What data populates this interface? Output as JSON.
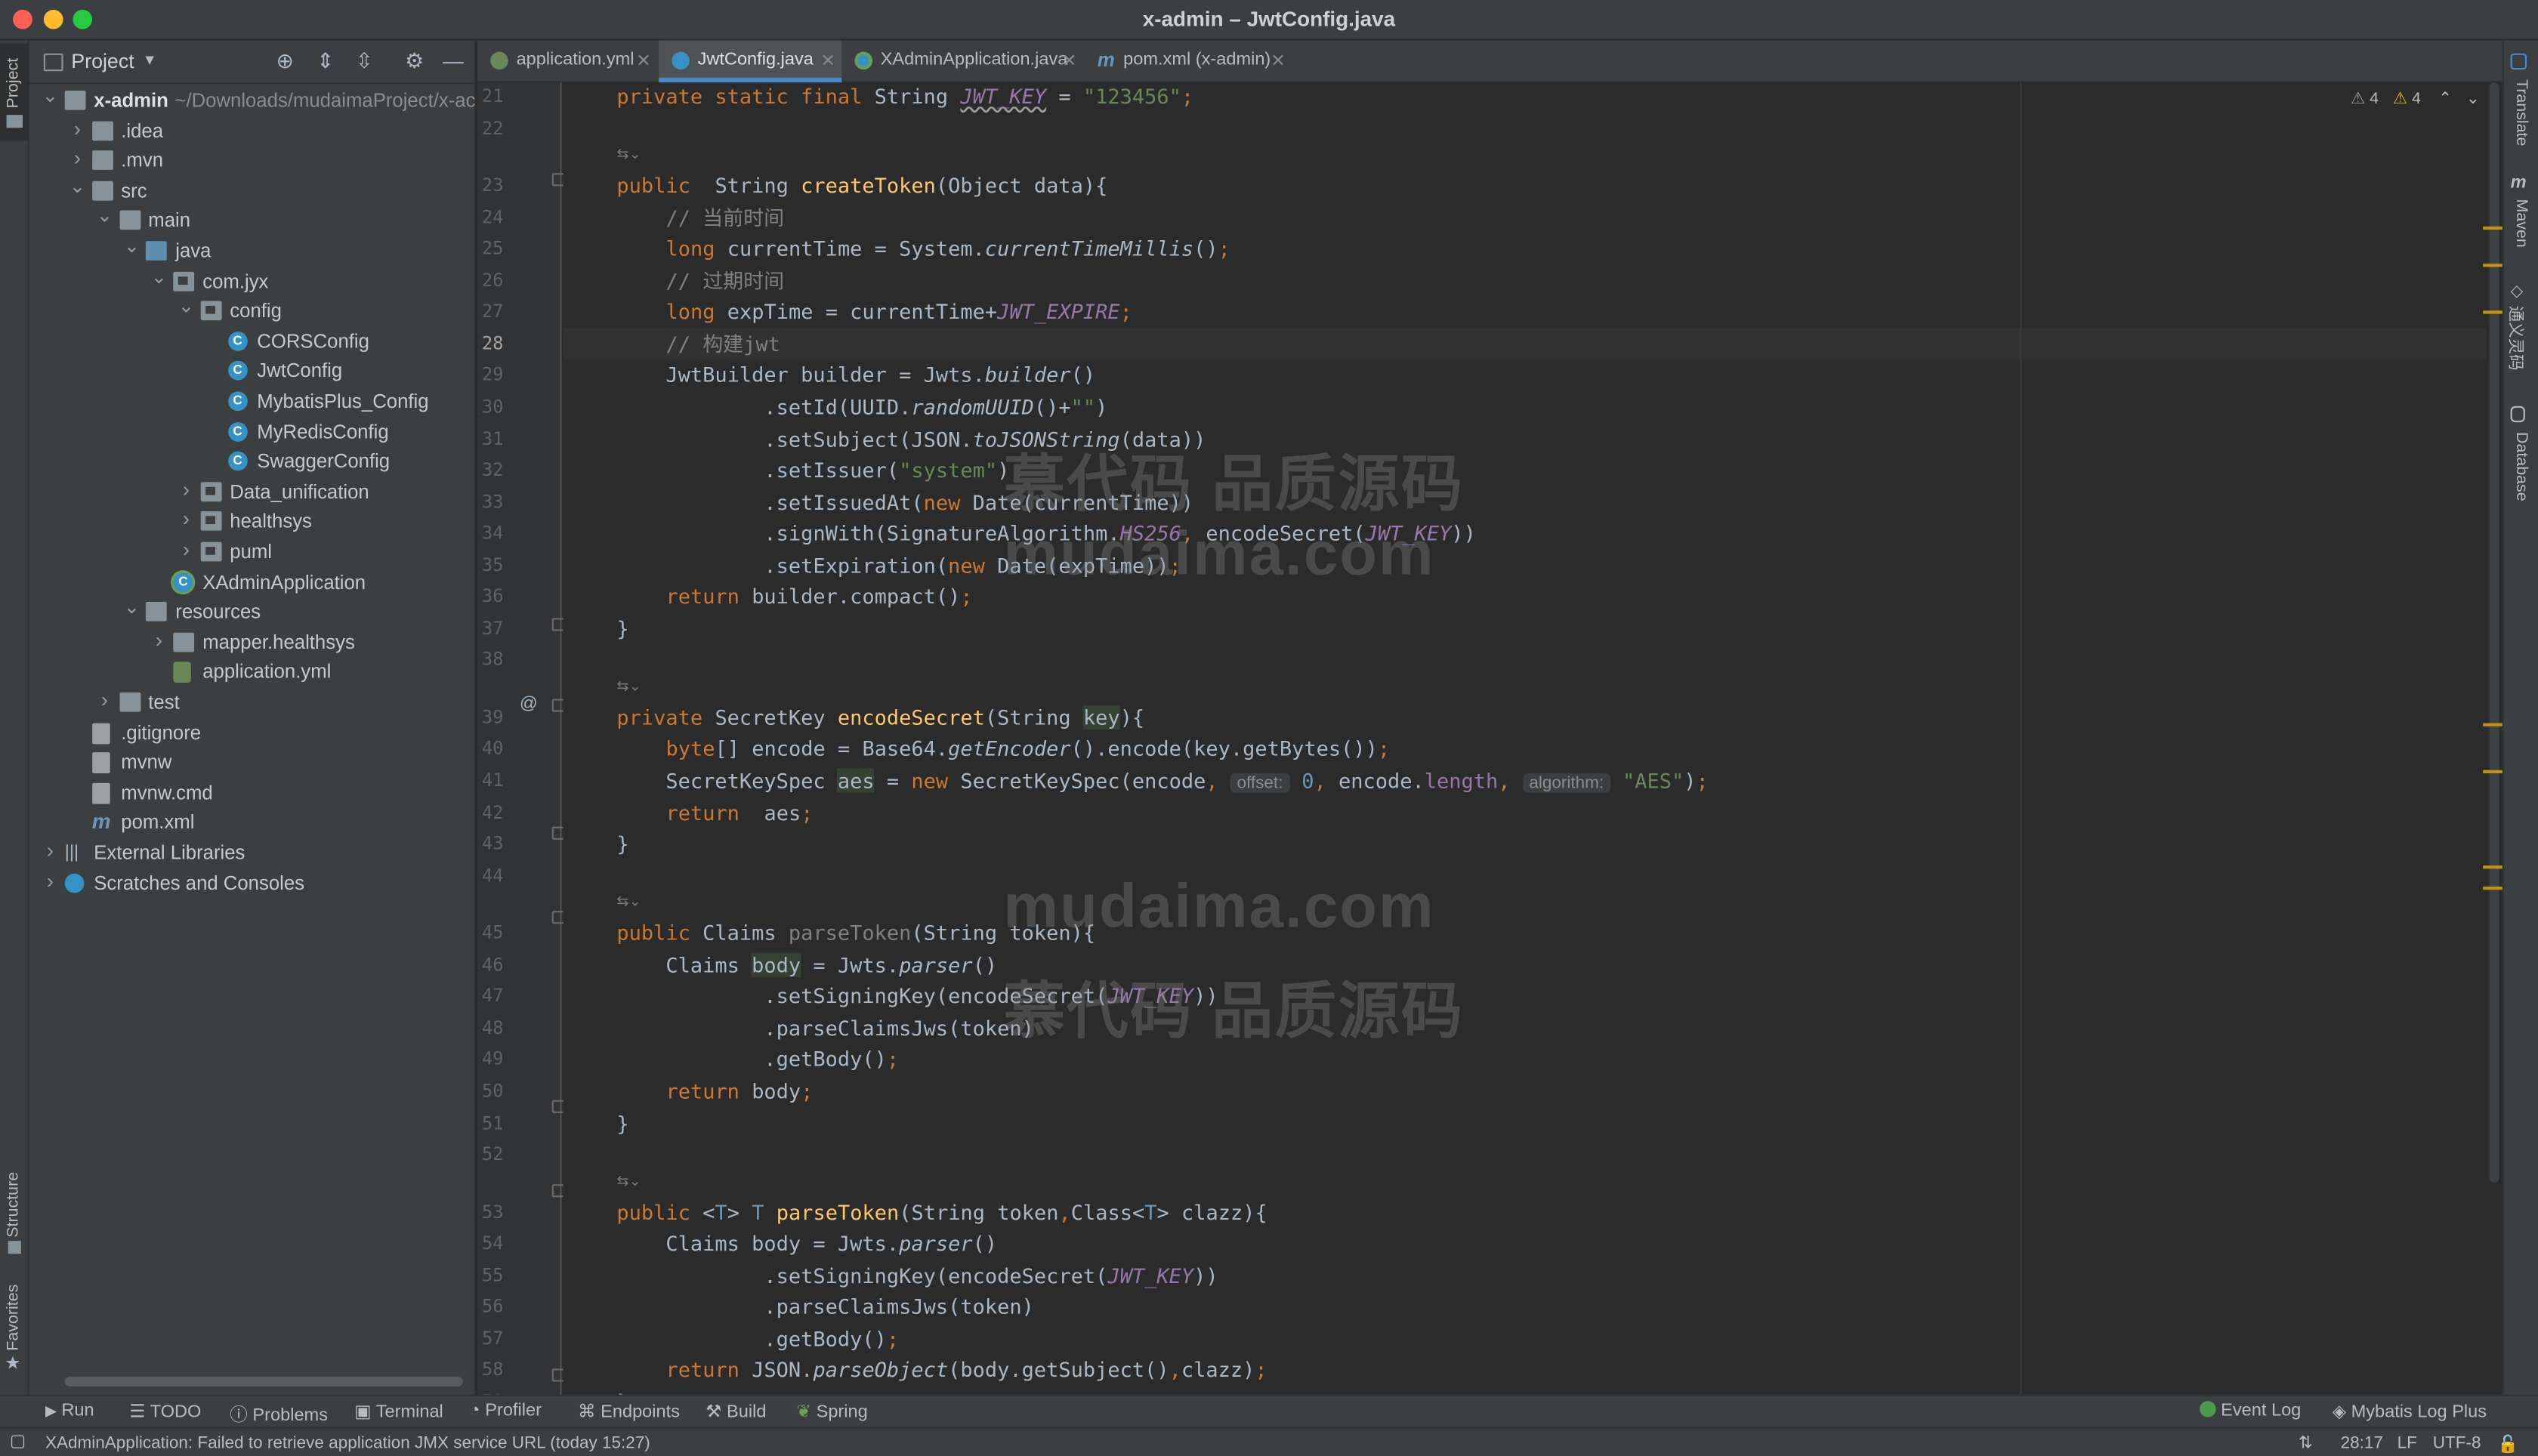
{
  "window": {
    "title": "x-admin – JwtConfig.java"
  },
  "left_stripe": {
    "project_label": "Project",
    "structure_label": "Structure",
    "favorites_label": "Favorites"
  },
  "project_panel": {
    "title": "Project",
    "tree": [
      {
        "label": "x-admin",
        "extra": " ~/Downloads/mudaimaProject/x-ac",
        "icon": "module-folder-icon",
        "expanded": true,
        "bold": true
      },
      {
        "label": ".idea",
        "icon": "folder-icon",
        "expanded": false
      },
      {
        "label": ".mvn",
        "icon": "folder-icon",
        "expanded": false
      },
      {
        "label": "src",
        "icon": "folder-icon",
        "expanded": true
      },
      {
        "label": "main",
        "icon": "folder-icon",
        "expanded": true
      },
      {
        "label": "java",
        "icon": "source-folder-icon",
        "expanded": true
      },
      {
        "label": "com.jyx",
        "icon": "package-icon",
        "expanded": true
      },
      {
        "label": "config",
        "icon": "package-icon",
        "expanded": true
      },
      {
        "label": "CORSConfig",
        "icon": "class-icon"
      },
      {
        "label": "JwtConfig",
        "icon": "class-icon"
      },
      {
        "label": "MybatisPlus_Config",
        "icon": "class-icon"
      },
      {
        "label": "MyRedisConfig",
        "icon": "class-icon"
      },
      {
        "label": "SwaggerConfig",
        "icon": "class-icon"
      },
      {
        "label": "Data_unification",
        "icon": "package-icon",
        "expanded": false
      },
      {
        "label": "healthsys",
        "icon": "package-icon",
        "expanded": false
      },
      {
        "label": "puml",
        "icon": "package-icon",
        "expanded": false
      },
      {
        "label": "XAdminApplication",
        "icon": "spring-class-icon"
      },
      {
        "label": "resources",
        "icon": "resources-folder-icon",
        "expanded": true
      },
      {
        "label": "mapper.healthsys",
        "icon": "folder-icon",
        "expanded": false
      },
      {
        "label": "application.yml",
        "icon": "yml-file-icon"
      },
      {
        "label": "test",
        "icon": "folder-icon",
        "expanded": false
      },
      {
        "label": ".gitignore",
        "icon": "gitignore-file-icon"
      },
      {
        "label": "mvnw",
        "icon": "script-file-icon"
      },
      {
        "label": "mvnw.cmd",
        "icon": "script-file-icon"
      },
      {
        "label": "pom.xml",
        "icon": "maven-file-icon"
      },
      {
        "label": "External Libraries",
        "icon": "library-icon",
        "expanded": false
      },
      {
        "label": "Scratches and Consoles",
        "icon": "scratches-icon",
        "expanded": false
      }
    ]
  },
  "tabs": [
    {
      "label": "application.yml",
      "icon": "yml-file-icon",
      "color": "#6a8759"
    },
    {
      "label": "JwtConfig.java",
      "icon": "class-icon",
      "color": "#3592c4"
    },
    {
      "label": "XAdminApplication.java",
      "icon": "spring-class-icon",
      "color": "#3592c4"
    },
    {
      "label": "pom.xml (x-admin)",
      "icon": "maven-file-icon",
      "color": "#6897bb"
    }
  ],
  "inspections": {
    "weak_warnings": "4",
    "warnings": "4"
  },
  "right_stripe": {
    "translate_label": "Translate",
    "maven_label": "Maven",
    "translation_label": "通义灵码",
    "database_label": "Database"
  },
  "editor": {
    "current_line": "28",
    "lines": [
      {
        "n": "21",
        "t": [
          [
            "kw",
            "private static final "
          ],
          [
            "",
            "String "
          ],
          [
            "st sq",
            "JWT_KEY"
          ],
          [
            "",
            " = "
          ],
          [
            "str",
            "\"123456\""
          ],
          [
            "kw",
            ";"
          ]
        ]
      },
      {
        "n": "22",
        "t": []
      },
      {
        "n": "",
        "t": [
          [
            "gr",
            "    "
          ]
        ]
      },
      {
        "n": "23",
        "t": [
          [
            "kw",
            "public  "
          ],
          [
            "",
            "String "
          ],
          [
            "fn",
            "createToken"
          ],
          [
            "",
            "(Object data){"
          ]
        ]
      },
      {
        "n": "24",
        "t": [
          [
            "",
            "    "
          ],
          [
            "cm",
            "// 当前时间"
          ]
        ]
      },
      {
        "n": "25",
        "t": [
          [
            "",
            "    "
          ],
          [
            "kw",
            "long "
          ],
          [
            "",
            "currentTime = System."
          ],
          [
            "it",
            "currentTimeMillis"
          ],
          [
            "",
            "()"
          ],
          [
            "kw",
            ";"
          ]
        ]
      },
      {
        "n": "26",
        "t": [
          [
            "",
            "    "
          ],
          [
            "cm",
            "// 过期时间"
          ]
        ]
      },
      {
        "n": "27",
        "t": [
          [
            "",
            "    "
          ],
          [
            "kw",
            "long "
          ],
          [
            "",
            "expTime = currentTime+"
          ],
          [
            "st",
            "JWT_EXPIRE"
          ],
          [
            "kw",
            ";"
          ]
        ]
      },
      {
        "n": "28",
        "t": [
          [
            "",
            "    "
          ],
          [
            "cm",
            "// 构建jwt"
          ]
        ]
      },
      {
        "n": "29",
        "t": [
          [
            "",
            "    JwtBuilder builder = Jwts."
          ],
          [
            "it",
            "builder"
          ],
          [
            "",
            "()"
          ]
        ]
      },
      {
        "n": "30",
        "t": [
          [
            "",
            "            .setId(UUID."
          ],
          [
            "it",
            "randomUUID"
          ],
          [
            "",
            "()+"
          ],
          [
            "str",
            "\"\""
          ],
          [
            "",
            ")"
          ]
        ]
      },
      {
        "n": "31",
        "t": [
          [
            "",
            "            .setSubject(JSON."
          ],
          [
            "it",
            "toJSONString"
          ],
          [
            "",
            "(data))"
          ]
        ]
      },
      {
        "n": "32",
        "t": [
          [
            "",
            "            .setIssuer("
          ],
          [
            "str",
            "\"system\""
          ],
          [
            "",
            ")"
          ]
        ]
      },
      {
        "n": "33",
        "t": [
          [
            "",
            "            .setIssuedAt("
          ],
          [
            "kw",
            "new "
          ],
          [
            "",
            "Date(currentTime))"
          ]
        ]
      },
      {
        "n": "34",
        "t": [
          [
            "",
            "            .signWith(SignatureAlgorithm."
          ],
          [
            "st",
            "HS256"
          ],
          [
            "kw",
            ", "
          ],
          [
            "",
            "encodeSecret("
          ],
          [
            "st",
            "JWT_KEY"
          ],
          [
            "",
            "))"
          ]
        ]
      },
      {
        "n": "35",
        "t": [
          [
            "",
            "            .setExpiration("
          ],
          [
            "kw",
            "new "
          ],
          [
            "",
            "Date(expTime))"
          ],
          [
            "kw",
            ";"
          ]
        ]
      },
      {
        "n": "36",
        "t": [
          [
            "",
            "    "
          ],
          [
            "kw",
            "return "
          ],
          [
            "",
            "builder.compact()"
          ],
          [
            "kw",
            ";"
          ]
        ]
      },
      {
        "n": "37",
        "t": [
          [
            "",
            "}"
          ]
        ]
      },
      {
        "n": "38",
        "t": []
      },
      {
        "n": "",
        "t": [
          [
            "gr",
            "    "
          ]
        ]
      },
      {
        "n": "39",
        "t": [
          [
            "kw",
            "private "
          ],
          [
            "",
            "SecretKey "
          ],
          [
            "fn",
            "encodeSecret"
          ],
          [
            "",
            "(String "
          ],
          [
            "hl",
            "key"
          ],
          [
            "",
            "){"
          ]
        ]
      },
      {
        "n": "40",
        "t": [
          [
            "",
            "    "
          ],
          [
            "kw",
            "byte"
          ],
          [
            "",
            "[] encode = Base64."
          ],
          [
            "it",
            "getEncoder"
          ],
          [
            "",
            "().encode(key.getBytes())"
          ],
          [
            "kw",
            ";"
          ]
        ]
      },
      {
        "n": "41",
        "t": [
          [
            "",
            "    SecretKeySpec "
          ],
          [
            "hl",
            "aes"
          ],
          [
            "",
            " = "
          ],
          [
            "kw",
            "new "
          ],
          [
            "",
            "SecretKeySpec(encode"
          ],
          [
            "kw",
            ", "
          ],
          [
            "hint",
            "offset:"
          ],
          [
            "",
            " "
          ],
          [
            "num",
            "0"
          ],
          [
            "kw",
            ", "
          ],
          [
            "",
            "encode."
          ],
          [
            "par",
            "length"
          ],
          [
            "kw",
            ", "
          ],
          [
            "hint",
            "algorithm:"
          ],
          [
            "",
            " "
          ],
          [
            "str",
            "\"AES\""
          ],
          [
            "",
            ")"
          ],
          [
            "kw",
            ";"
          ]
        ]
      },
      {
        "n": "42",
        "t": [
          [
            "",
            "    "
          ],
          [
            "kw",
            "return  "
          ],
          [
            "",
            "aes"
          ],
          [
            "kw",
            ";"
          ]
        ]
      },
      {
        "n": "43",
        "t": [
          [
            "",
            "}"
          ]
        ]
      },
      {
        "n": "44",
        "t": []
      },
      {
        "n": "",
        "t": [
          [
            "gr",
            "    "
          ]
        ]
      },
      {
        "n": "45",
        "t": [
          [
            "kw",
            "public "
          ],
          [
            "",
            "Claims "
          ],
          [
            "gr",
            "parseToken"
          ],
          [
            "",
            "(String token){"
          ]
        ]
      },
      {
        "n": "46",
        "t": [
          [
            "",
            "    Claims "
          ],
          [
            "hl",
            "body"
          ],
          [
            "",
            " = Jwts."
          ],
          [
            "it",
            "parser"
          ],
          [
            "",
            "()"
          ]
        ]
      },
      {
        "n": "47",
        "t": [
          [
            "",
            "            .setSigningKey(encodeSecret("
          ],
          [
            "st",
            "JWT_KEY"
          ],
          [
            "",
            "))"
          ]
        ]
      },
      {
        "n": "48",
        "t": [
          [
            "",
            "            .parseClaimsJws(token)"
          ]
        ]
      },
      {
        "n": "49",
        "t": [
          [
            "",
            "            .getBody()"
          ],
          [
            "kw",
            ";"
          ]
        ]
      },
      {
        "n": "50",
        "t": [
          [
            "",
            "    "
          ],
          [
            "kw",
            "return "
          ],
          [
            "",
            "body"
          ],
          [
            "kw",
            ";"
          ]
        ]
      },
      {
        "n": "51",
        "t": [
          [
            "",
            "}"
          ]
        ]
      },
      {
        "n": "52",
        "t": []
      },
      {
        "n": "",
        "t": [
          [
            "gr",
            "    "
          ]
        ]
      },
      {
        "n": "53",
        "t": [
          [
            "kw",
            "public "
          ],
          [
            "",
            "<"
          ],
          [
            "num",
            "T"
          ],
          [
            "",
            "> "
          ],
          [
            "num",
            "T "
          ],
          [
            "fn",
            "parseToken"
          ],
          [
            "",
            "(String token"
          ],
          [
            "kw",
            ","
          ],
          [
            "",
            "Class<"
          ],
          [
            "num",
            "T"
          ],
          [
            "",
            "> clazz){"
          ]
        ]
      },
      {
        "n": "54",
        "t": [
          [
            "",
            "    Claims body = Jwts."
          ],
          [
            "it",
            "parser"
          ],
          [
            "",
            "()"
          ]
        ]
      },
      {
        "n": "55",
        "t": [
          [
            "",
            "            .setSigningKey(encodeSecret("
          ],
          [
            "st",
            "JWT_KEY"
          ],
          [
            "",
            "))"
          ]
        ]
      },
      {
        "n": "56",
        "t": [
          [
            "",
            "            .parseClaimsJws(token)"
          ]
        ]
      },
      {
        "n": "57",
        "t": [
          [
            "",
            "            .getBody()"
          ],
          [
            "kw",
            ";"
          ]
        ]
      },
      {
        "n": "58",
        "t": [
          [
            "",
            "    "
          ],
          [
            "kw",
            "return "
          ],
          [
            "",
            "JSON."
          ],
          [
            "it",
            "parseObject"
          ],
          [
            "",
            "(body.getSubject()"
          ],
          [
            "kw",
            ","
          ],
          [
            "",
            "clazz)"
          ],
          [
            "kw",
            ";"
          ]
        ]
      },
      {
        "n": "59",
        "t": [
          [
            "",
            "}"
          ]
        ]
      }
    ]
  },
  "watermarks": [
    "慕代码 品质源码",
    "mudaima.com",
    "mudaima.com",
    "慕代码 品质源码"
  ],
  "bottom_toolbar": {
    "items": [
      "Run",
      "TODO",
      "Problems",
      "Terminal",
      "Profiler",
      "Endpoints",
      "Build",
      "Spring"
    ],
    "event_log": "Event Log",
    "mybatis": "Mybatis Log Plus"
  },
  "status_bar": {
    "message": "XAdminApplication: Failed to retrieve application JMX service URL (today 15:27)",
    "position": "28:17",
    "line_sep": "LF",
    "encoding": "UTF-8"
  },
  "colors": {
    "accent": "#4a88c7",
    "keyword": "#cc7832",
    "string": "#6a8759",
    "function": "#ffc66d",
    "static_field": "#9876aa",
    "comment": "#808080"
  }
}
